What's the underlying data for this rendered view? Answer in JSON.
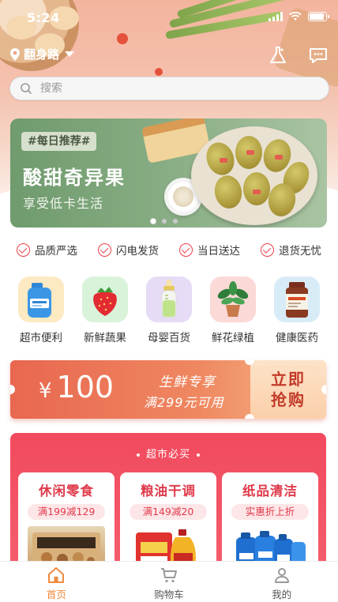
{
  "status_bar": {
    "time": "5:24"
  },
  "header": {
    "location": "翻身路",
    "search_placeholder": "搜索"
  },
  "banner": {
    "tag": "#每日推荐#",
    "headline": "酸甜奇异果",
    "subline": "享受低卡生活",
    "page_count": 3,
    "active_page": 1
  },
  "guarantees": [
    "品质严选",
    "闪电发货",
    "当日送达",
    "退货无忧"
  ],
  "categories": [
    {
      "label": "超市便利",
      "icon": "detergent-bottle-icon"
    },
    {
      "label": "新鲜蔬果",
      "icon": "strawberry-icon"
    },
    {
      "label": "母婴百货",
      "icon": "baby-bottle-icon"
    },
    {
      "label": "鲜花绿植",
      "icon": "potted-plant-icon"
    },
    {
      "label": "健康医药",
      "icon": "vitamin-bottle-icon"
    }
  ],
  "coupon": {
    "symbol": "¥",
    "amount": "100",
    "line1": "生鲜专享",
    "line2": "满299元可用",
    "cta_line1": "立即",
    "cta_line2": "抢购"
  },
  "market": {
    "title": "超市必买",
    "cards": [
      {
        "title": "休闲零食",
        "promo": "满199减129"
      },
      {
        "title": "粮油干调",
        "promo": "满149减20"
      },
      {
        "title": "纸品清洁",
        "promo": "实惠折上折"
      }
    ]
  },
  "tabs": [
    {
      "label": "首页",
      "icon": "home-icon",
      "active": true
    },
    {
      "label": "购物车",
      "icon": "cart-icon",
      "active": false
    },
    {
      "label": "我的",
      "icon": "user-icon",
      "active": false
    }
  ],
  "colors": {
    "accent_red": "#e8404a",
    "tab_active": "#f08a3c",
    "market_bg": "#f24a5e",
    "banner_green": "#86ab82"
  }
}
